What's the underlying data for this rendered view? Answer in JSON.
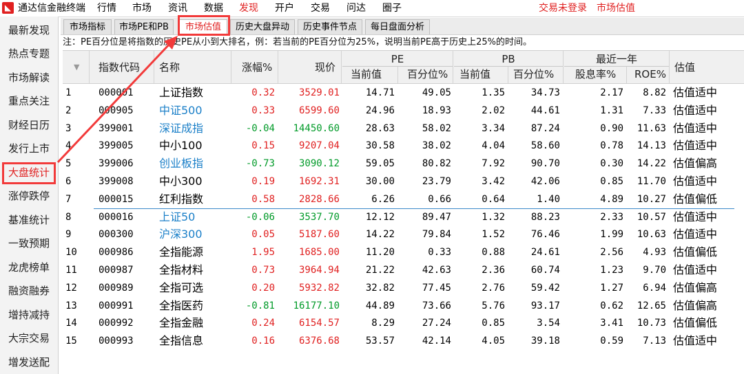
{
  "app": {
    "title": "通达信金融终端",
    "logo": "logo",
    "menu": [
      "行情",
      "市场",
      "资讯",
      "数据",
      "发现",
      "开户",
      "交易",
      "问达",
      "圈子"
    ],
    "active_menu": "发现",
    "status": [
      "交易未登录",
      "市场估值"
    ]
  },
  "sidebar": {
    "items": [
      "最新发现",
      "热点专题",
      "市场解读",
      "重点关注",
      "财经日历",
      "发行上市",
      "大盘统计",
      "涨停跌停",
      "基准统计",
      "一致预期",
      "龙虎榜单",
      "融资融券",
      "增持减持",
      "大宗交易",
      "增发送配"
    ],
    "active": "大盘统计"
  },
  "tabs": {
    "items": [
      "市场指标",
      "市场PE和PB",
      "市场估值",
      "历史大盘异动",
      "历史事件节点",
      "每日盘面分析"
    ],
    "active": "市场估值"
  },
  "note": "注：PE百分位是将指数的历史PE从小到大排名，例：若当前的PE百分位为25%，说明当前PE高于历史上25%的时间。",
  "table": {
    "headers": {
      "sort": "▼",
      "code": "指数代码",
      "name": "名称",
      "change": "涨幅%",
      "price": "现价",
      "pe": "PE",
      "pe_current": "当前值",
      "pe_pct": "百分位%",
      "pb": "PB",
      "pb_current": "当前值",
      "pb_pct": "百分位%",
      "recent_year": "最近一年",
      "div": "股息率%",
      "roe": "ROE%",
      "valuation": "估值"
    },
    "rows": [
      {
        "no": "1",
        "code": "000001",
        "name": "上证指数",
        "change": "0.32",
        "price": "3529.01",
        "pe": "14.71",
        "pe_pct": "49.05",
        "pb": "1.35",
        "pb_pct": "34.73",
        "div": "2.17",
        "roe": "8.82",
        "val": "估值适中",
        "link": false,
        "dir": "up"
      },
      {
        "no": "2",
        "code": "000905",
        "name": "中证500",
        "change": "0.33",
        "price": "6599.60",
        "pe": "24.96",
        "pe_pct": "18.93",
        "pb": "2.02",
        "pb_pct": "44.61",
        "div": "1.31",
        "roe": "7.33",
        "val": "估值适中",
        "link": true,
        "dir": "up"
      },
      {
        "no": "3",
        "code": "399001",
        "name": "深证成指",
        "change": "-0.04",
        "price": "14450.60",
        "pe": "28.63",
        "pe_pct": "58.02",
        "pb": "3.34",
        "pb_pct": "87.24",
        "div": "0.90",
        "roe": "11.63",
        "val": "估值适中",
        "link": true,
        "dir": "down"
      },
      {
        "no": "4",
        "code": "399005",
        "name": "中小100",
        "change": "0.15",
        "price": "9207.04",
        "pe": "30.58",
        "pe_pct": "38.02",
        "pb": "4.04",
        "pb_pct": "58.60",
        "div": "0.78",
        "roe": "14.13",
        "val": "估值适中",
        "link": false,
        "dir": "up"
      },
      {
        "no": "5",
        "code": "399006",
        "name": "创业板指",
        "change": "-0.73",
        "price": "3090.12",
        "pe": "59.05",
        "pe_pct": "80.82",
        "pb": "7.92",
        "pb_pct": "90.70",
        "div": "0.30",
        "roe": "14.22",
        "val": "估值偏高",
        "link": true,
        "dir": "down"
      },
      {
        "no": "6",
        "code": "399008",
        "name": "中小300",
        "change": "0.19",
        "price": "1692.31",
        "pe": "30.00",
        "pe_pct": "23.79",
        "pb": "3.42",
        "pb_pct": "42.06",
        "div": "0.85",
        "roe": "11.70",
        "val": "估值适中",
        "link": false,
        "dir": "up"
      },
      {
        "no": "7",
        "code": "000015",
        "name": "红利指数",
        "change": "0.58",
        "price": "2828.66",
        "pe": "6.26",
        "pe_pct": "0.66",
        "pb": "0.64",
        "pb_pct": "1.40",
        "div": "4.89",
        "roe": "10.27",
        "val": "估值偏低",
        "link": false,
        "dir": "up"
      },
      {
        "no": "8",
        "code": "000016",
        "name": "上证50",
        "change": "-0.06",
        "price": "3537.70",
        "pe": "12.12",
        "pe_pct": "89.47",
        "pb": "1.32",
        "pb_pct": "88.23",
        "div": "2.33",
        "roe": "10.57",
        "val": "估值适中",
        "link": true,
        "dir": "down"
      },
      {
        "no": "9",
        "code": "000300",
        "name": "沪深300",
        "change": "0.05",
        "price": "5187.60",
        "pe": "14.22",
        "pe_pct": "79.84",
        "pb": "1.52",
        "pb_pct": "76.46",
        "div": "1.99",
        "roe": "10.63",
        "val": "估值适中",
        "link": true,
        "dir": "up"
      },
      {
        "no": "10",
        "code": "000986",
        "name": "全指能源",
        "change": "1.95",
        "price": "1685.00",
        "pe": "11.20",
        "pe_pct": "0.33",
        "pb": "0.88",
        "pb_pct": "24.61",
        "div": "2.56",
        "roe": "4.93",
        "val": "估值偏低",
        "link": false,
        "dir": "up"
      },
      {
        "no": "11",
        "code": "000987",
        "name": "全指材料",
        "change": "0.73",
        "price": "3964.94",
        "pe": "21.22",
        "pe_pct": "42.63",
        "pb": "2.36",
        "pb_pct": "60.74",
        "div": "1.23",
        "roe": "9.70",
        "val": "估值适中",
        "link": false,
        "dir": "up"
      },
      {
        "no": "12",
        "code": "000989",
        "name": "全指可选",
        "change": "0.20",
        "price": "5932.82",
        "pe": "32.82",
        "pe_pct": "77.45",
        "pb": "2.76",
        "pb_pct": "59.42",
        "div": "1.27",
        "roe": "6.94",
        "val": "估值偏高",
        "link": false,
        "dir": "up"
      },
      {
        "no": "13",
        "code": "000991",
        "name": "全指医药",
        "change": "-0.81",
        "price": "16177.10",
        "pe": "44.89",
        "pe_pct": "73.66",
        "pb": "5.76",
        "pb_pct": "93.17",
        "div": "0.62",
        "roe": "12.65",
        "val": "估值偏高",
        "link": false,
        "dir": "down"
      },
      {
        "no": "14",
        "code": "000992",
        "name": "全指金融",
        "change": "0.24",
        "price": "6154.57",
        "pe": "8.29",
        "pe_pct": "27.24",
        "pb": "0.85",
        "pb_pct": "3.54",
        "div": "3.41",
        "roe": "10.73",
        "val": "估值偏低",
        "link": false,
        "dir": "up"
      },
      {
        "no": "15",
        "code": "000993",
        "name": "全指信息",
        "change": "0.16",
        "price": "6376.68",
        "pe": "53.57",
        "pe_pct": "42.14",
        "pb": "4.05",
        "pb_pct": "39.18",
        "div": "0.59",
        "roe": "7.13",
        "val": "估值适中",
        "link": false,
        "dir": "up"
      }
    ]
  },
  "colors": {
    "accent": "#e02020",
    "up": "#e02020",
    "down": "#009a28",
    "link": "#1a7fc8",
    "annotation": "#f23a3a"
  }
}
